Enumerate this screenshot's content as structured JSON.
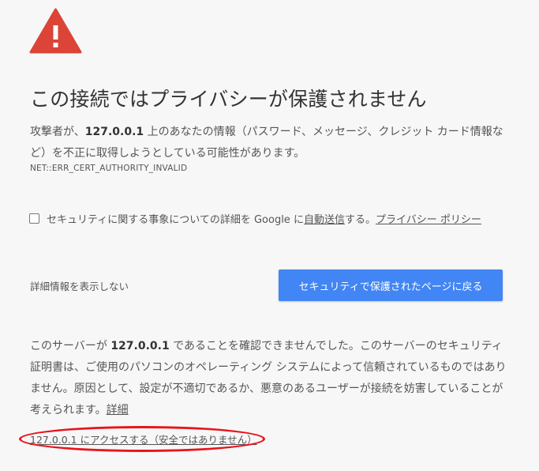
{
  "colors": {
    "warning": "#db4437",
    "button": "#4285f4",
    "background": "#f7f7f7",
    "annotation": "#e8141c"
  },
  "icon": "warning-triangle-icon",
  "heading": "この接続ではプライバシーが保護されません",
  "main_message": {
    "before": "攻撃者が、",
    "host": "127.0.0.1",
    "after": " 上のあなたの情報（パスワード、メッセージ、クレジット カード情報など）を不正に取得しようとしている可能性があります。"
  },
  "error_code": "NET::ERR_CERT_AUTHORITY_INVALID",
  "opt_in": {
    "checked": false,
    "text_before": "セキュリティに関する事象についての詳細を Google に",
    "auto_send_link": "自動送信",
    "text_middle": "する。",
    "privacy_link": "プライバシー ポリシー"
  },
  "details_toggle": "詳細情報を表示しない",
  "primary_button": "セキュリティで保護されたページに戻る",
  "details": {
    "before": "このサーバーが ",
    "host": "127.0.0.1",
    "after": " であることを確認できませんでした。このサーバーのセキュリティ証明書は、ご使用のパソコンのオペレーティング システムによって信頼されているものではありません。原因として、設定が不適切であるか、悪意のあるユーザーが接続を妨害していることが考えられます。",
    "link": "詳細"
  },
  "proceed_link": "127.0.0.1 にアクセスする（安全ではありません）"
}
